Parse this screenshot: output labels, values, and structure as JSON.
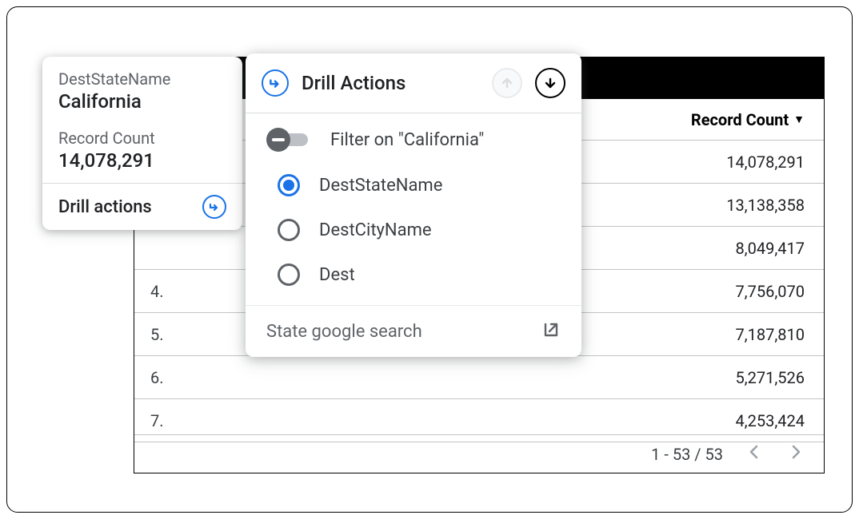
{
  "tooltip": {
    "dim_label": "DestStateName",
    "dim_value": "California",
    "metric_label": "Record Count",
    "metric_value": "14,078,291",
    "drill_label": "Drill actions"
  },
  "drill_panel": {
    "title": "Drill Actions",
    "filter_label": "Filter on \"California\"",
    "options": [
      {
        "label": "DestStateName",
        "selected": true
      },
      {
        "label": "DestCityName",
        "selected": false
      },
      {
        "label": "Dest",
        "selected": false
      }
    ],
    "search_label": "State google search"
  },
  "table": {
    "column_header": "Record Count",
    "rows": [
      {
        "num": "",
        "value": "14,078,291"
      },
      {
        "num": "",
        "value": "13,138,358"
      },
      {
        "num": "",
        "value": "8,049,417"
      },
      {
        "num": "4.",
        "value": "7,756,070"
      },
      {
        "num": "5.",
        "value": "7,187,810"
      },
      {
        "num": "6.",
        "value": "5,271,526"
      },
      {
        "num": "7.",
        "value": "4,253,424"
      }
    ],
    "page_info": "1 - 53 / 53"
  }
}
